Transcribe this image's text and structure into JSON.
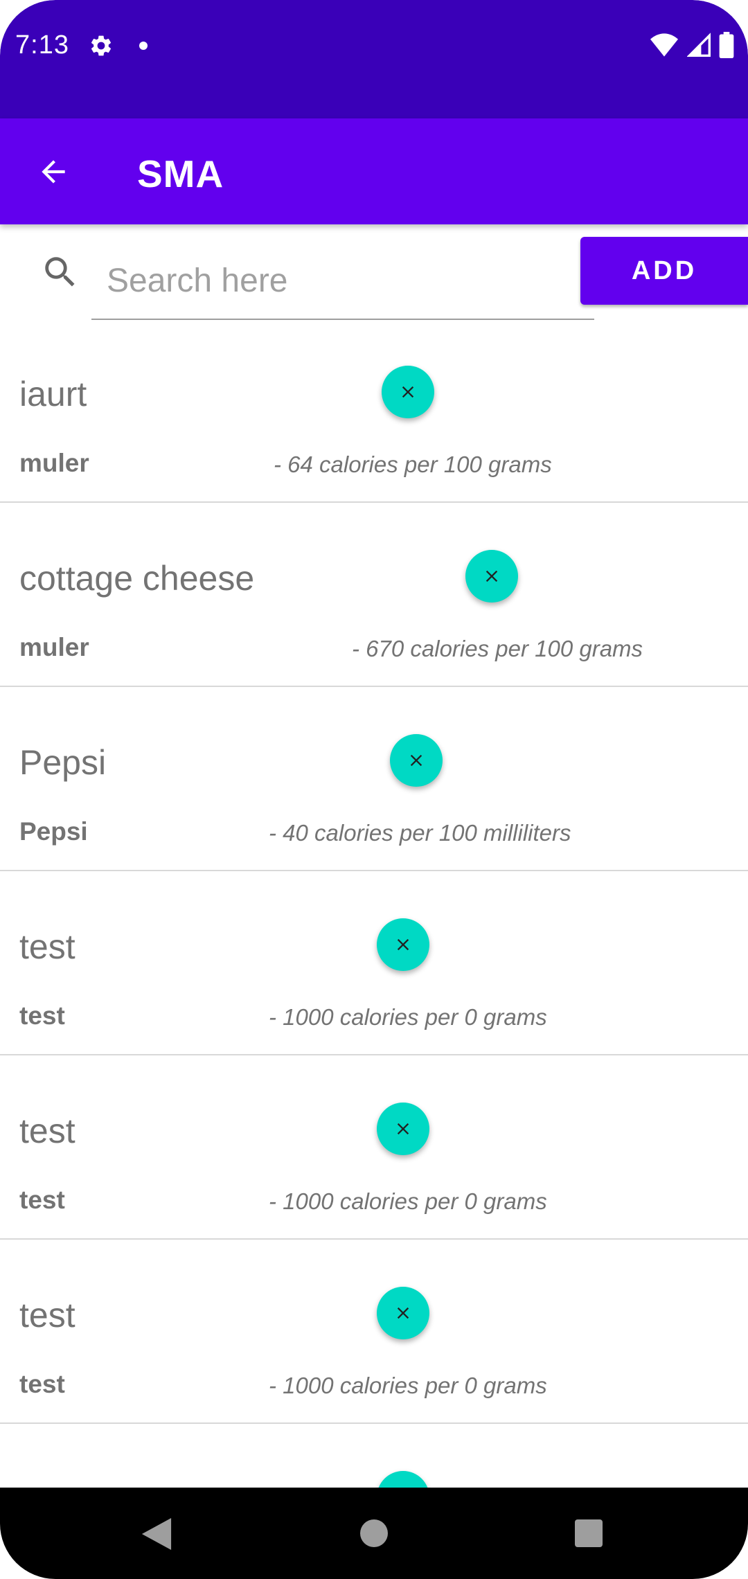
{
  "status_bar": {
    "time": "7:13"
  },
  "app_bar": {
    "title": "SMA"
  },
  "search": {
    "placeholder": "Search here",
    "value": ""
  },
  "add_button": {
    "label": "ADD"
  },
  "colors": {
    "status_bar": "#3a00b8",
    "primary": "#6200ee",
    "accent": "#00d9c4"
  },
  "foods": [
    {
      "name": "iaurt",
      "brand": "muler",
      "calories": "- 64 calories per 100 grams"
    },
    {
      "name": "cottage cheese",
      "brand": "muler",
      "calories": "- 670 calories per 100 grams"
    },
    {
      "name": "Pepsi",
      "brand": "Pepsi",
      "calories": "- 40 calories per 100 milliliters"
    },
    {
      "name": "test",
      "brand": "test",
      "calories": "- 1000 calories per 0 grams"
    },
    {
      "name": "test",
      "brand": "test",
      "calories": "- 1000 calories per 0 grams"
    },
    {
      "name": "test",
      "brand": "test",
      "calories": "- 1000 calories per 0 grams"
    }
  ]
}
